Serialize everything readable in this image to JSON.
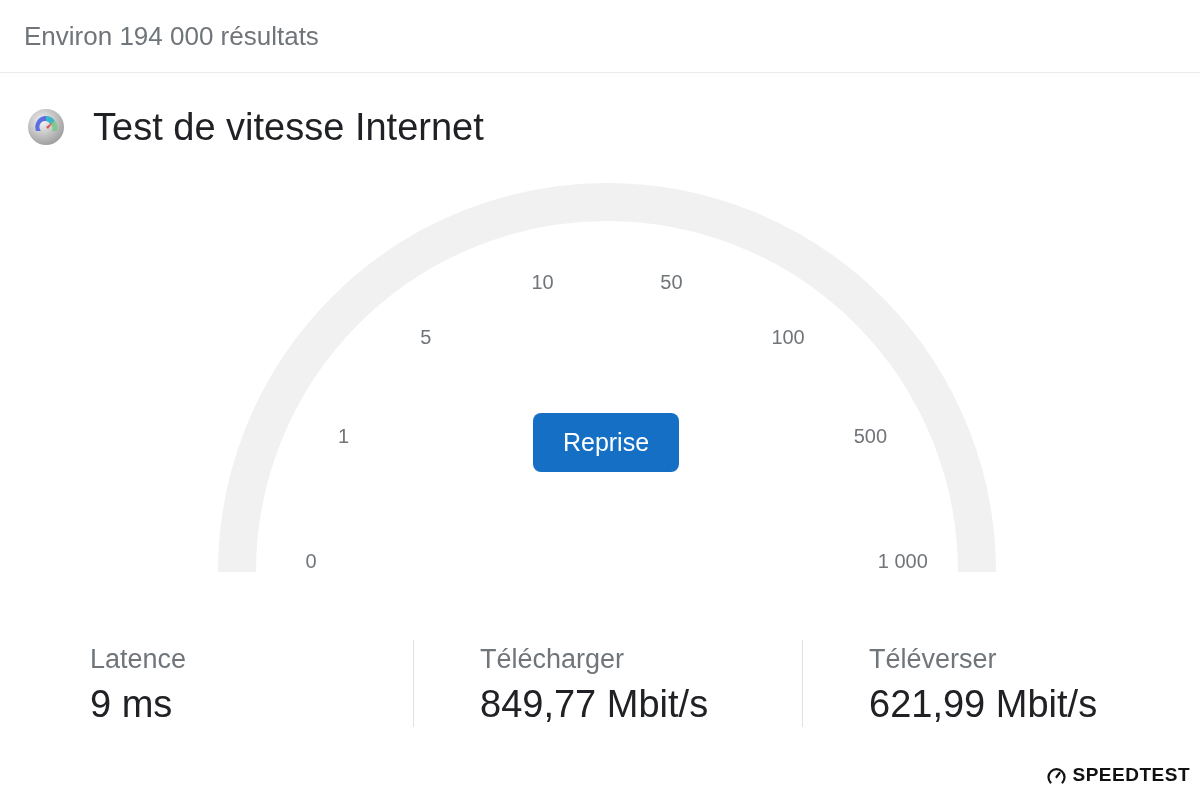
{
  "header": {
    "results_count": "Environ 194 000 résultats"
  },
  "widget": {
    "title": "Test de vitesse Internet",
    "gauge": {
      "ticks": [
        "0",
        "1",
        "5",
        "10",
        "50",
        "100",
        "500",
        "1 000"
      ]
    },
    "button": {
      "label": "Reprise"
    },
    "stats": [
      {
        "label": "Latence",
        "value": "9 ms"
      },
      {
        "label": "Télécharger",
        "value": "849,77 Mbit/s"
      },
      {
        "label": "Téléverser",
        "value": "621,99 Mbit/s"
      }
    ],
    "branding": {
      "logo_text": "SPEEDTEST"
    }
  }
}
